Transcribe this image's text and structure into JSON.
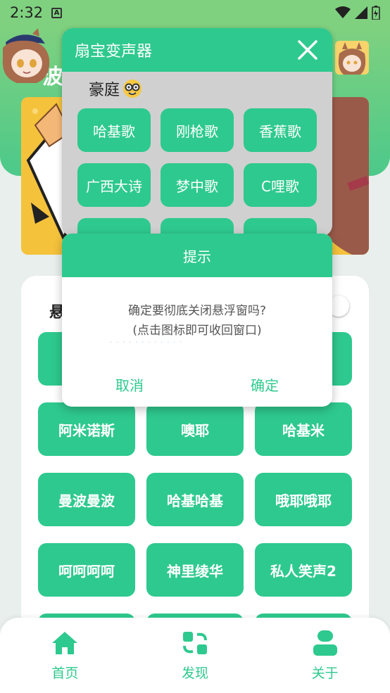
{
  "status_bar": {
    "time": "2:32"
  },
  "header": {
    "title_partial": "波"
  },
  "main_card": {
    "label_partial": "悬",
    "buttons": [
      "阿米诺斯",
      "噢耶",
      "哈基米",
      "曼波曼波",
      "哈基哈基",
      "哦耶哦耶",
      "呵呵呵呵",
      "神里绫华",
      "私人笑声2"
    ]
  },
  "bottom_nav": [
    {
      "label": "首页",
      "icon": "home-icon"
    },
    {
      "label": "发现",
      "icon": "discover-icon"
    },
    {
      "label": "关于",
      "icon": "user-icon"
    }
  ],
  "floating_window": {
    "title": "扇宝变声器",
    "subtitle": "豪庭",
    "subtitle_emoji": "nerd-face-icon",
    "buttons": [
      "哈基歌",
      "刚枪歌",
      "香蕉歌",
      "广西大诗",
      "梦中歌",
      "C哩歌"
    ]
  },
  "dialog": {
    "title": "提示",
    "message_line1": "确定要彻底关闭悬浮窗吗?",
    "message_line2": "(点击图标即可收回窗口)",
    "cancel_label": "取消",
    "confirm_label": "确定"
  },
  "colors": {
    "accent": "#2ec98e",
    "header_green": "#7fd17f",
    "float_bg": "#d0d0d0"
  }
}
